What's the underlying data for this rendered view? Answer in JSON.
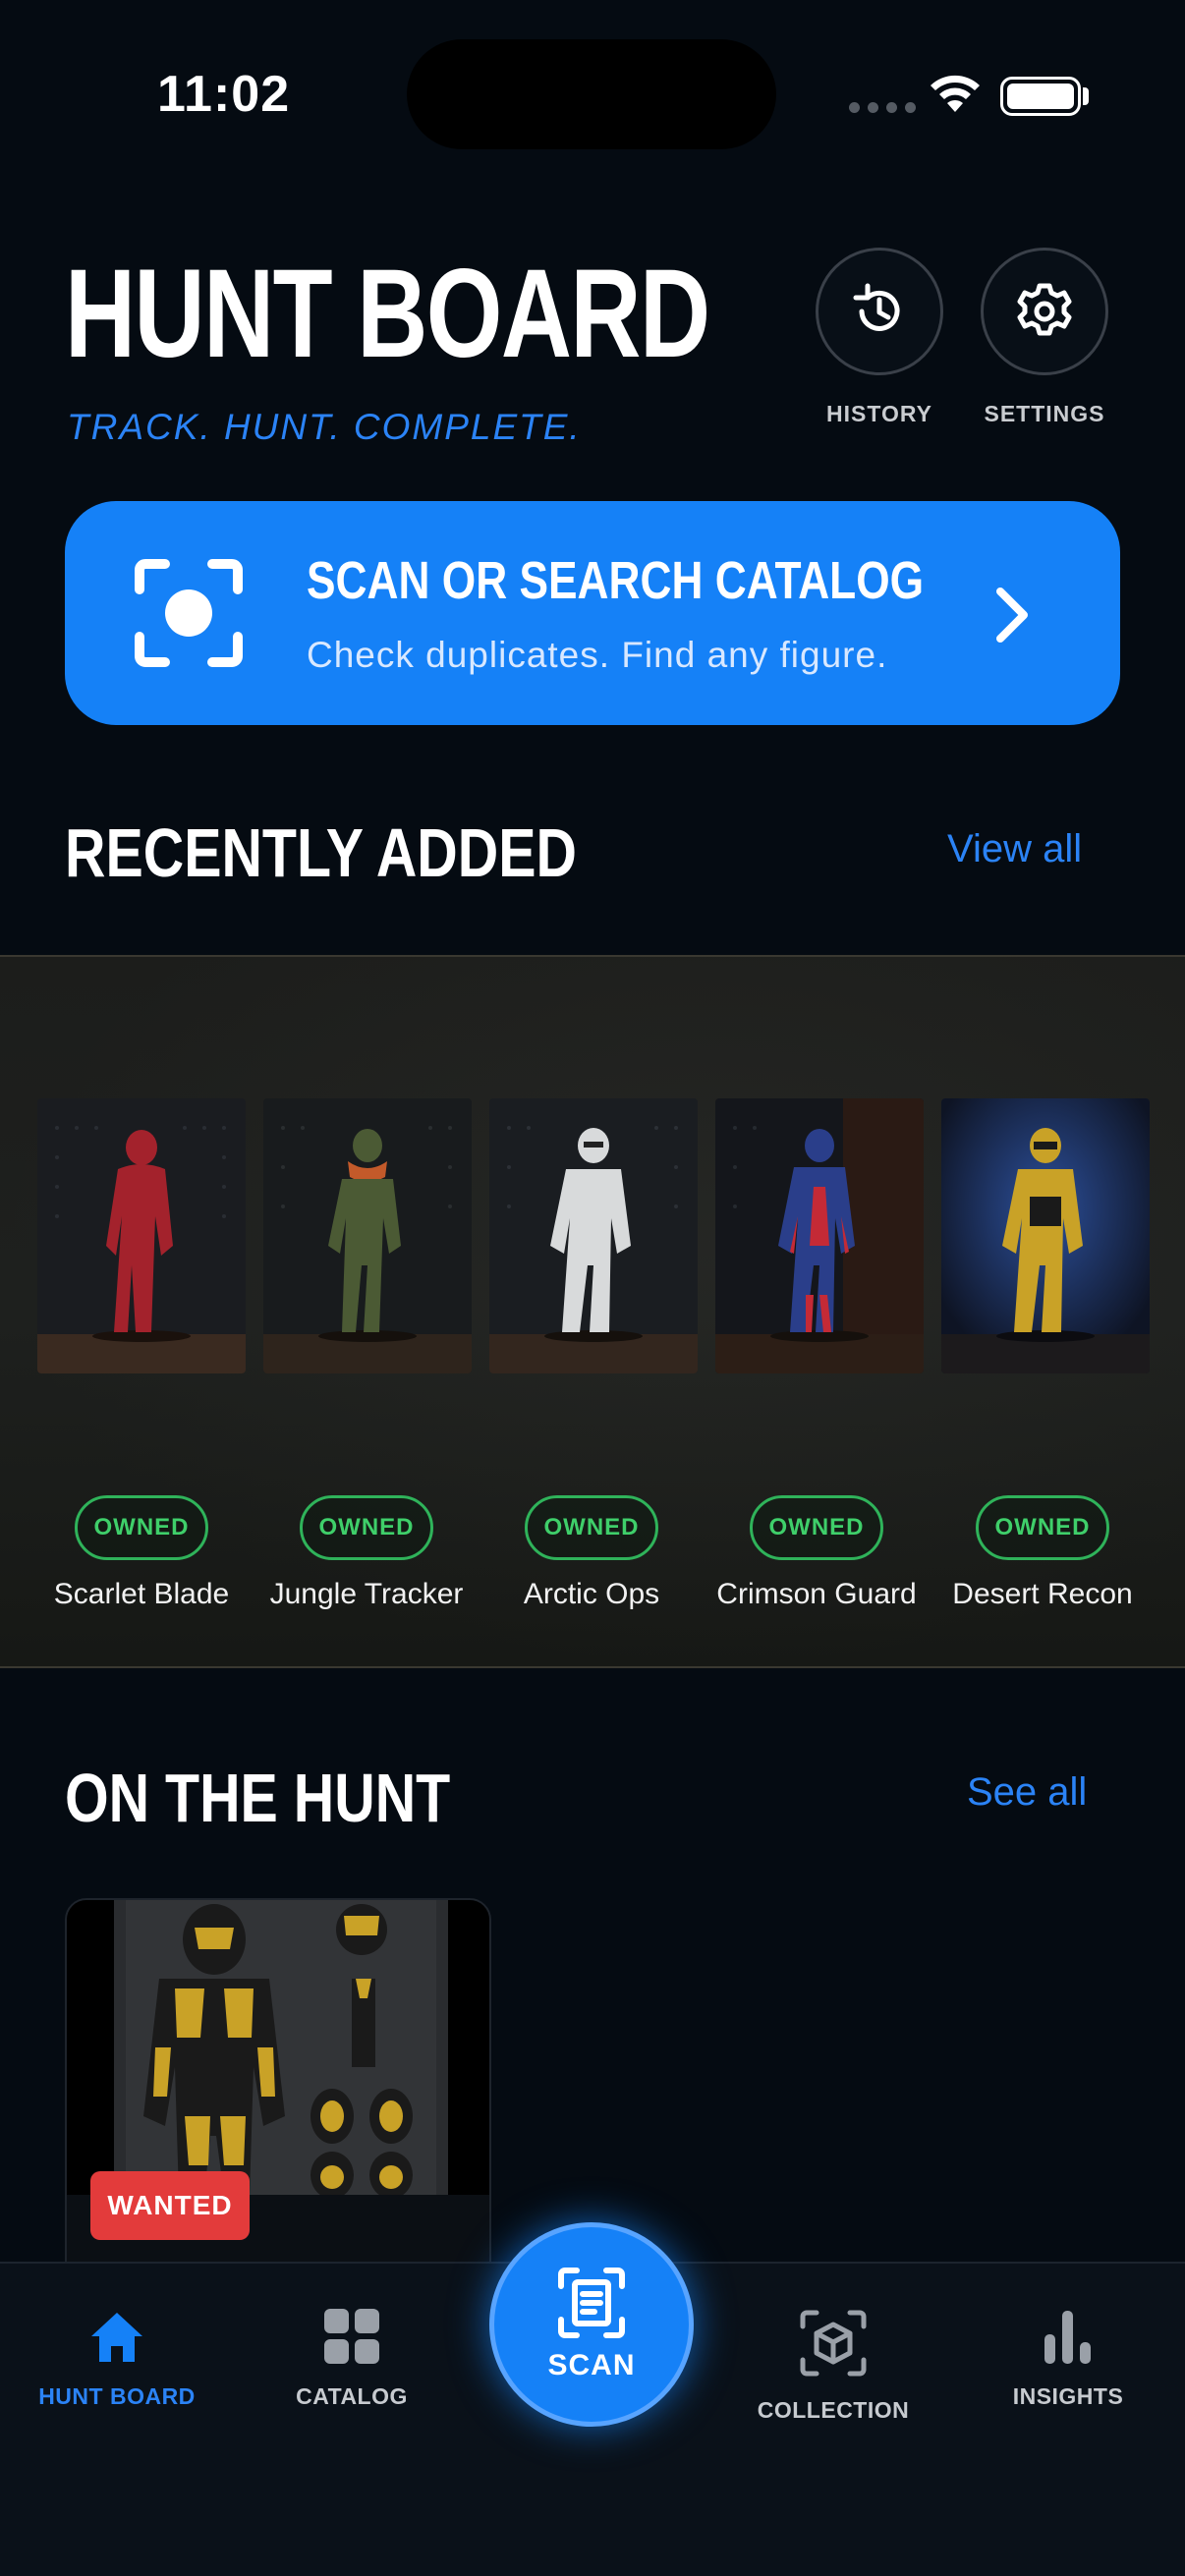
{
  "status_bar": {
    "time": "11:02"
  },
  "header": {
    "title": "HUNT BOARD",
    "tagline": "TRACK. HUNT. COMPLETE.",
    "history_label": "HISTORY",
    "settings_label": "SETTINGS"
  },
  "scan_banner": {
    "title": "SCAN OR SEARCH CATALOG",
    "subtitle": "Check duplicates. Find any figure."
  },
  "recently_added": {
    "title": "RECENTLY ADDED",
    "link": "View all",
    "items": [
      {
        "name": "Scarlet Blade",
        "badge": "OWNED",
        "color": "#a3222c"
      },
      {
        "name": "Jungle Tracker",
        "badge": "OWNED",
        "color": "#4b5a34"
      },
      {
        "name": "Arctic Ops",
        "badge": "OWNED",
        "color": "#d8dadb"
      },
      {
        "name": "Crimson Guard",
        "badge": "OWNED",
        "color": "#2a3e8a"
      },
      {
        "name": "Desert Recon",
        "badge": "OWNED",
        "color": "#c9a227"
      }
    ]
  },
  "on_the_hunt": {
    "title": "ON THE HUNT",
    "link": "See all",
    "items": [
      {
        "badge": "WANTED"
      }
    ]
  },
  "bottom_nav": {
    "hunt_board": "HUNT BOARD",
    "catalog": "CATALOG",
    "scan": "SCAN",
    "collection": "COLLECTION",
    "insights": "INSIGHTS"
  },
  "colors": {
    "accent": "#1581f7",
    "owned": "#2fb35a",
    "wanted": "#e33b3b",
    "background": "#050b12"
  }
}
